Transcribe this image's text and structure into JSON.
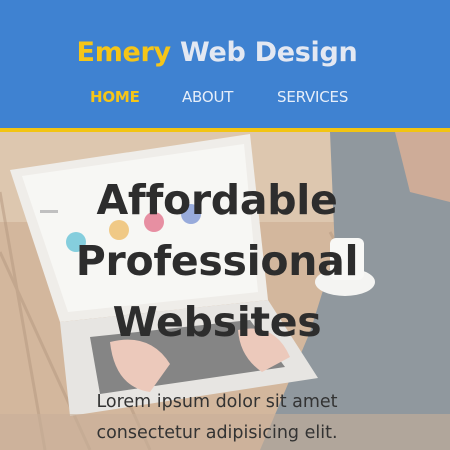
{
  "brand": {
    "first": "Emery",
    "rest": "Web Design"
  },
  "nav": [
    {
      "label": "HOME",
      "active": true
    },
    {
      "label": "ABOUT",
      "active": false
    },
    {
      "label": "SERVICES",
      "active": false
    }
  ],
  "hero": {
    "headline_lines": [
      "Affordable",
      "Professional",
      "Websites"
    ],
    "tagline_lines": [
      "Lorem ipsum dolor sit amet",
      "consectetur adipisicing elit."
    ]
  },
  "colors": {
    "header_bg": "#3f82d1",
    "accent": "#f5c518",
    "divider": "#f2c412",
    "headline": "#2d2d2d"
  }
}
